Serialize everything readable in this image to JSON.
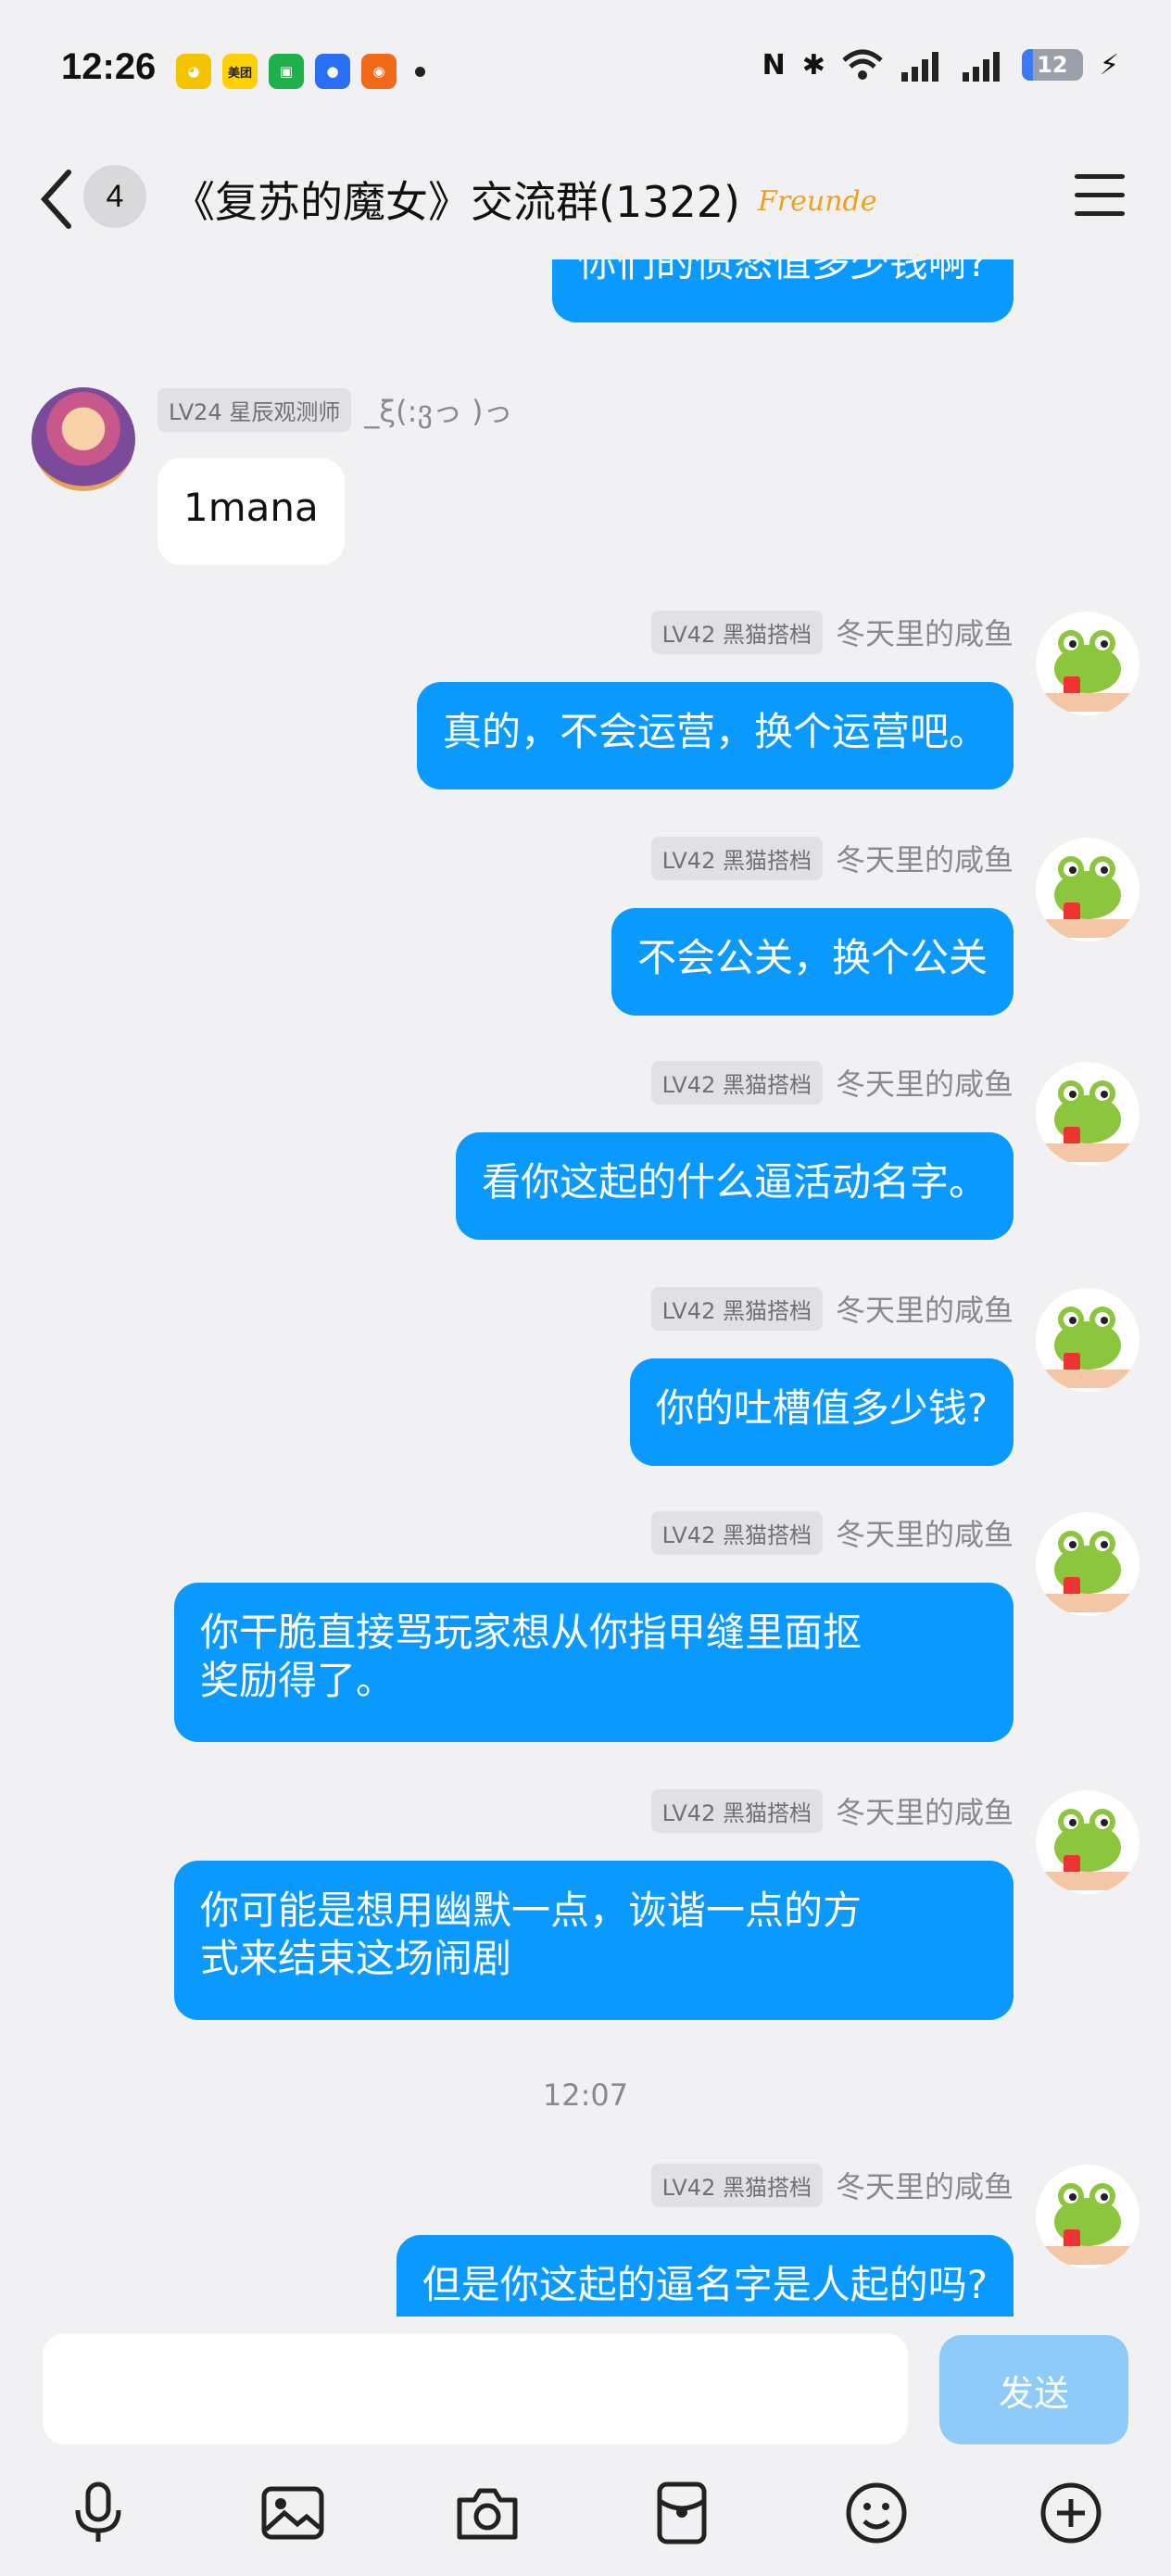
{
  "status_bar": {
    "time": "12:26",
    "apps": [
      "bili",
      "美团",
      "wx",
      "cc",
      "wb"
    ],
    "battery": "12"
  },
  "header": {
    "unread_count": "4",
    "title": "《复苏的魔女》交流群(1322)",
    "tag": "Freunde"
  },
  "messages": [
    {
      "text": "你们的愤怒值多少钱啊?"
    },
    {
      "level": "LV24 星辰观测师",
      "nick": "_ξ(:ვっ )っ",
      "text": "1mana"
    },
    {
      "level": "LV42 黑猫搭档",
      "nick": "冬天里的咸鱼",
      "text": "真的，不会运营，换个运营吧。"
    },
    {
      "level": "LV42 黑猫搭档",
      "nick": "冬天里的咸鱼",
      "text": "不会公关，换个公关"
    },
    {
      "level": "LV42 黑猫搭档",
      "nick": "冬天里的咸鱼",
      "text": "看你这起的什么逼活动名字。"
    },
    {
      "level": "LV42 黑猫搭档",
      "nick": "冬天里的咸鱼",
      "text": "你的吐槽值多少钱?"
    },
    {
      "level": "LV42 黑猫搭档",
      "nick": "冬天里的咸鱼",
      "line1": "你干脆直接骂玩家想从你指甲缝里面抠",
      "line2": "奖励得了。"
    },
    {
      "level": "LV42 黑猫搭档",
      "nick": "冬天里的咸鱼",
      "line1": "你可能是想用幽默一点，诙谐一点的方",
      "line2": "式来结束这场闹剧"
    },
    {
      "level": "LV42 黑猫搭档",
      "nick": "冬天里的咸鱼",
      "text": "但是你这起的逼名字是人起的吗?"
    }
  ],
  "timestamp": "12:07",
  "input": {
    "value": "",
    "send_label": "发送"
  },
  "colors": {
    "outgoing_bubble": "#0a99ff",
    "send_button": "#8ecbf8",
    "background": "#f1f1f3"
  },
  "toolbar_icons": [
    "microphone-icon",
    "image-icon",
    "camera-icon",
    "red-packet-icon",
    "emoji-icon",
    "plus-icon"
  ]
}
